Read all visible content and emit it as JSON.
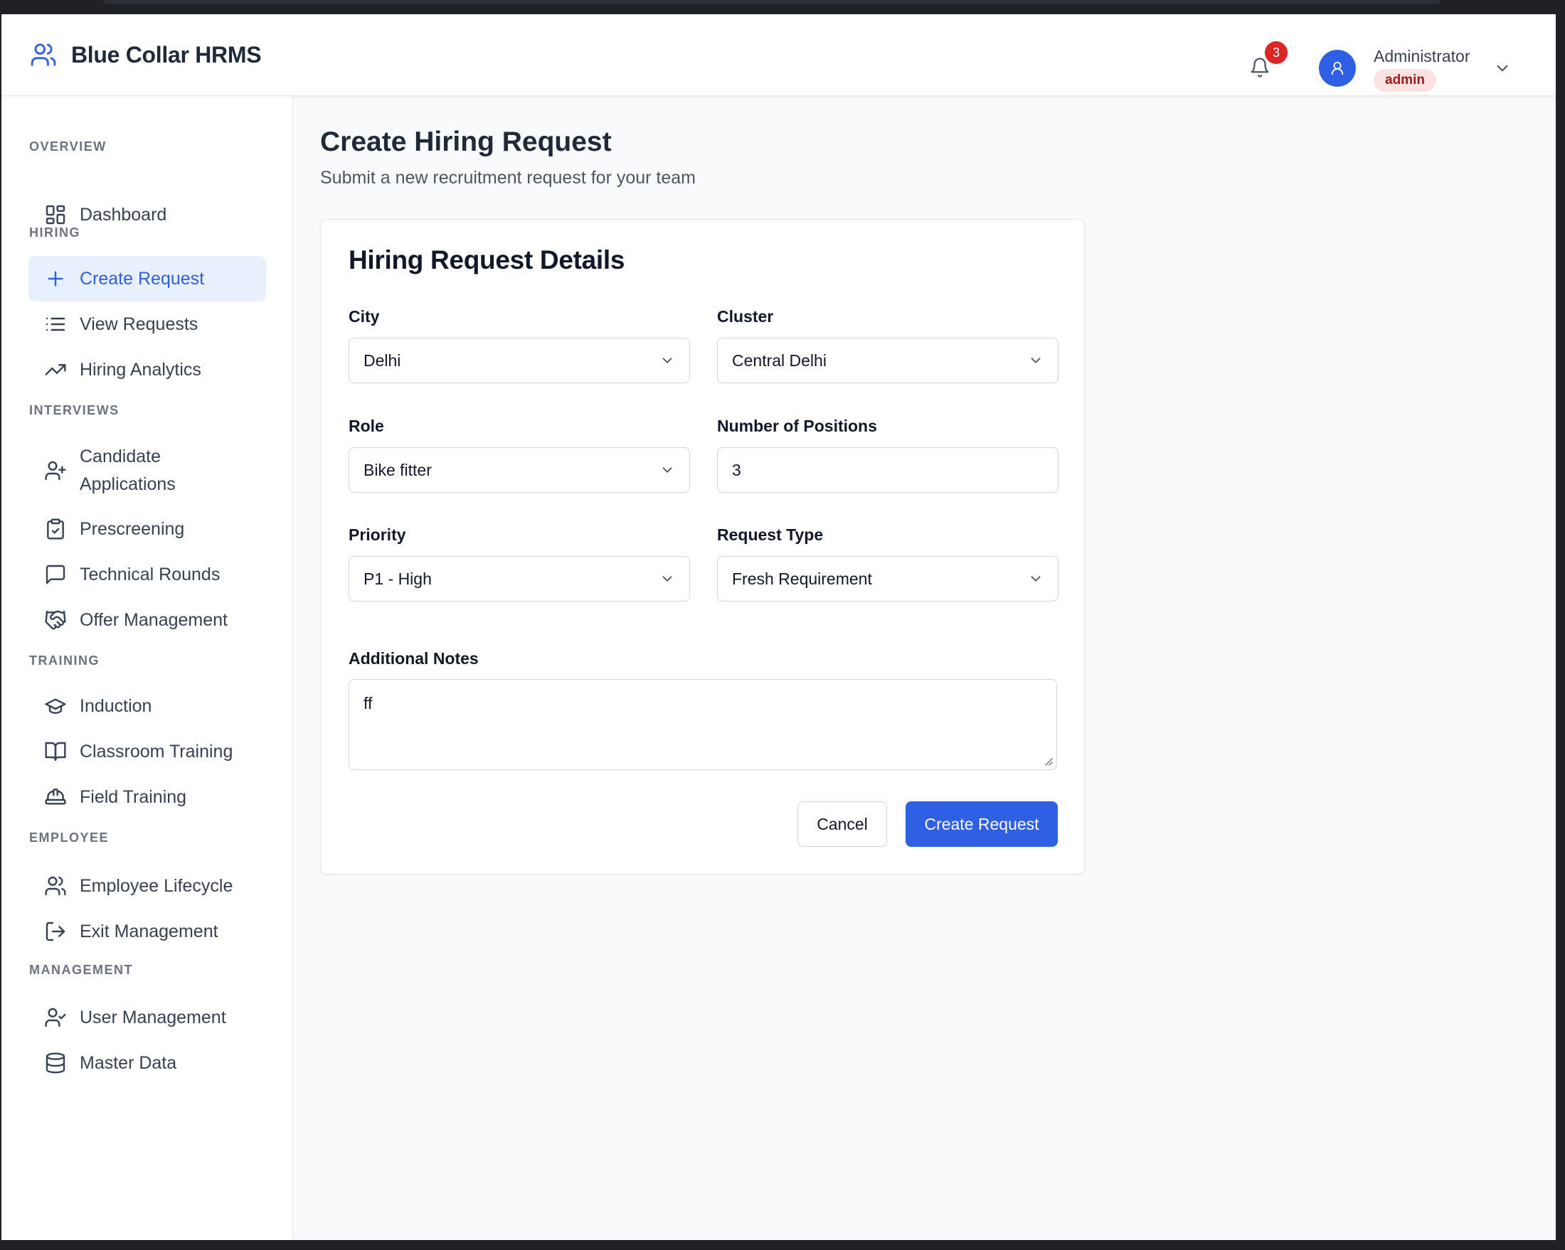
{
  "header": {
    "app_title": "Blue Collar HRMS",
    "notification_count": "3",
    "user_name": "Administrator",
    "user_role": "admin"
  },
  "sidebar": {
    "sections": {
      "overview": "OVERVIEW",
      "hiring": "HIRING",
      "interviews": "INTERVIEWS",
      "training": "TRAINING",
      "employee": "EMPLOYEE",
      "management": "MANAGEMENT"
    },
    "items": {
      "dashboard": "Dashboard",
      "create_request": "Create Request",
      "view_requests": "View Requests",
      "hiring_analytics": "Hiring Analytics",
      "candidate_applications_1": "Candidate",
      "candidate_applications_2": "Applications",
      "prescreening": "Prescreening",
      "technical_rounds": "Technical Rounds",
      "offer_management": "Offer Management",
      "induction": "Induction",
      "classroom_training": "Classroom Training",
      "field_training": "Field Training",
      "employee_lifecycle": "Employee Lifecycle",
      "exit_management": "Exit Management",
      "user_management": "User Management",
      "master_data": "Master Data"
    },
    "active_item": "create_request"
  },
  "main": {
    "title": "Create Hiring Request",
    "subtitle": "Submit a new recruitment request for your team",
    "card_title": "Hiring Request Details",
    "fields": {
      "city": {
        "label": "City",
        "value": "Delhi"
      },
      "cluster": {
        "label": "Cluster",
        "value": "Central Delhi"
      },
      "role": {
        "label": "Role",
        "value": "Bike fitter"
      },
      "positions": {
        "label": "Number of Positions",
        "value": "3"
      },
      "priority": {
        "label": "Priority",
        "value": "P1 - High"
      },
      "request_type": {
        "label": "Request Type",
        "value": "Fresh Requirement"
      },
      "notes": {
        "label": "Additional Notes",
        "value": "ff"
      }
    },
    "buttons": {
      "cancel": "Cancel",
      "submit": "Create Request"
    }
  },
  "colors": {
    "accent": "#2f5fe3",
    "active_bg": "#e8effd",
    "badge": "#dc2626",
    "role_badge_bg": "#fde2e2",
    "role_badge_text": "#991b1b"
  },
  "icons": {
    "brand": "users-icon",
    "notifications": "bell-icon",
    "avatar": "user-icon",
    "menu": "chevron-down-icon"
  }
}
